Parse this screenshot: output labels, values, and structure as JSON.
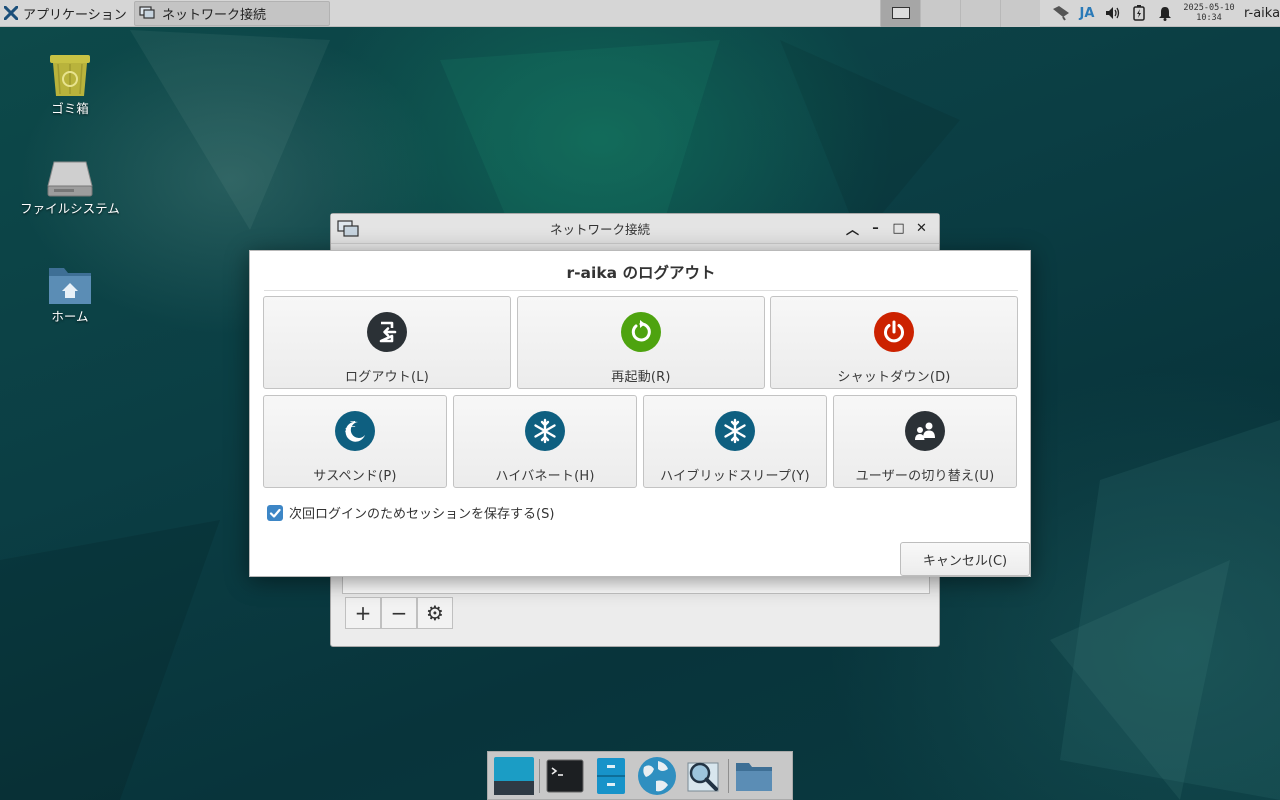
{
  "top_panel": {
    "apps_menu_label": "アプリケーション",
    "task_label": "ネットワーク接続",
    "input_method": "JA",
    "clock_date": "2025-05-10",
    "clock_time": "10:34",
    "username": "r-aika"
  },
  "desktop": {
    "icons": [
      {
        "label": "ゴミ箱",
        "icon": "trash-icon"
      },
      {
        "label": "ファイルシステム",
        "icon": "drive-icon"
      },
      {
        "label": "ホーム",
        "icon": "home-folder-icon"
      }
    ]
  },
  "bg_window": {
    "title": "ネットワーク接続",
    "toolbar": {
      "add": "+",
      "remove": "−",
      "settings": "⚙"
    }
  },
  "dialog": {
    "title": "r-aika のログアウト",
    "actions_row1": [
      {
        "label": "ログアウト(L)",
        "icon": "logout-icon",
        "color": "#2b3136"
      },
      {
        "label": "再起動(R)",
        "icon": "restart-icon",
        "color": "#4ea30f"
      },
      {
        "label": "シャットダウン(D)",
        "icon": "power-icon",
        "color": "#cc2200"
      }
    ],
    "actions_row2": [
      {
        "label": "サスペンド(P)",
        "icon": "moon-icon",
        "color": "#0e5f80"
      },
      {
        "label": "ハイバネート(H)",
        "icon": "snowflake-icon",
        "color": "#0e5f80"
      },
      {
        "label": "ハイブリッドスリープ(Y)",
        "icon": "snowflake-icon",
        "color": "#0e5f80"
      },
      {
        "label": "ユーザーの切り替え(U)",
        "icon": "switch-user-icon",
        "color": "#2b3136"
      }
    ],
    "save_session_label": "次回ログインのためセッションを保存する(S)",
    "save_session_checked": true,
    "cancel_label": "キャンセル(C)"
  },
  "dock": {
    "items": [
      "show-desktop-icon",
      "terminal-icon",
      "file-manager-icon",
      "web-browser-icon",
      "search-icon",
      "folder-icon"
    ]
  }
}
